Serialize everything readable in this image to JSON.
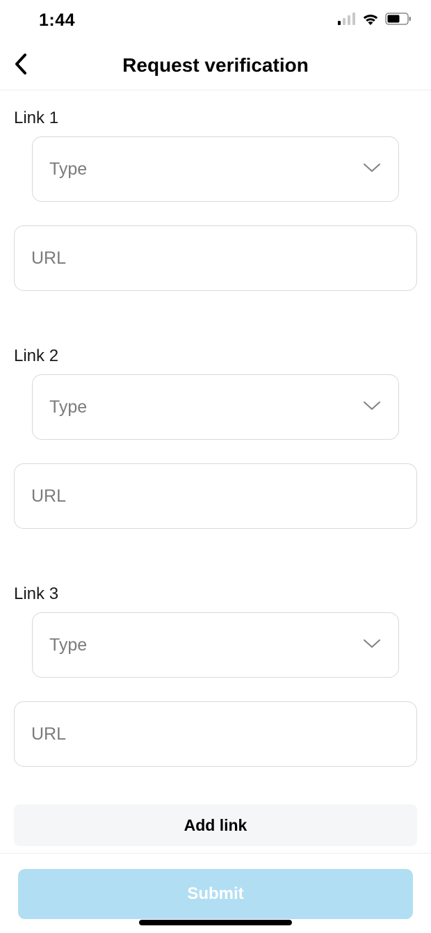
{
  "status": {
    "time": "1:44"
  },
  "nav": {
    "title": "Request verification"
  },
  "form": {
    "links": [
      {
        "label": "Link 1",
        "type_placeholder": "Type",
        "url_placeholder": "URL"
      },
      {
        "label": "Link 2",
        "type_placeholder": "Type",
        "url_placeholder": "URL"
      },
      {
        "label": "Link 3",
        "type_placeholder": "Type",
        "url_placeholder": "URL"
      }
    ],
    "add_link_label": "Add link",
    "submit_label": "Submit"
  }
}
